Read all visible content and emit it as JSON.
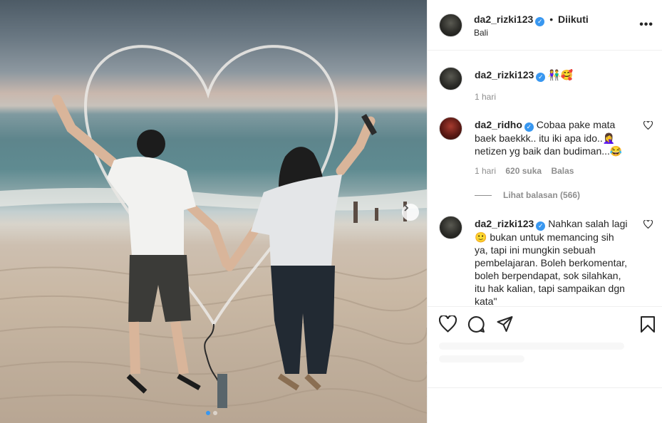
{
  "post": {
    "username": "da2_rizki123",
    "follow_label": "Diikuti",
    "location": "Bali",
    "more_label": "•••"
  },
  "comments": [
    {
      "username": "da2_rizki123",
      "text": "👫🥰",
      "time": "1 hari"
    },
    {
      "username": "da2_ridho",
      "text": "Cobaa pake mata baek baekkk.. itu iki apa ido..🤦‍♀️ netizen yg baik dan budiman...😂",
      "time": "1 hari",
      "likes": "620 suka",
      "reply_label": "Balas",
      "view_replies": "Lihat balasan (566)"
    },
    {
      "username": "da2_rizki123",
      "text": "Nahkan salah lagi 🙂 bukan untuk memancing sih ya, tapi ini mungkin sebuah pembelajaran. Boleh berkomentar, boleh berpendapat, sok silahkan, itu hak kalian, tapi sampaikan dgn kata\""
    }
  ],
  "icons": [
    "heart-icon",
    "comment-icon",
    "share-icon",
    "bookmark-icon",
    "chevron-right-icon",
    "verified-badge-icon"
  ],
  "colors": {
    "accent": "#3897f0",
    "text": "#262626",
    "muted": "#8e8e8e",
    "border": "#efefef"
  },
  "carousel": {
    "total": 2,
    "current": 1
  }
}
